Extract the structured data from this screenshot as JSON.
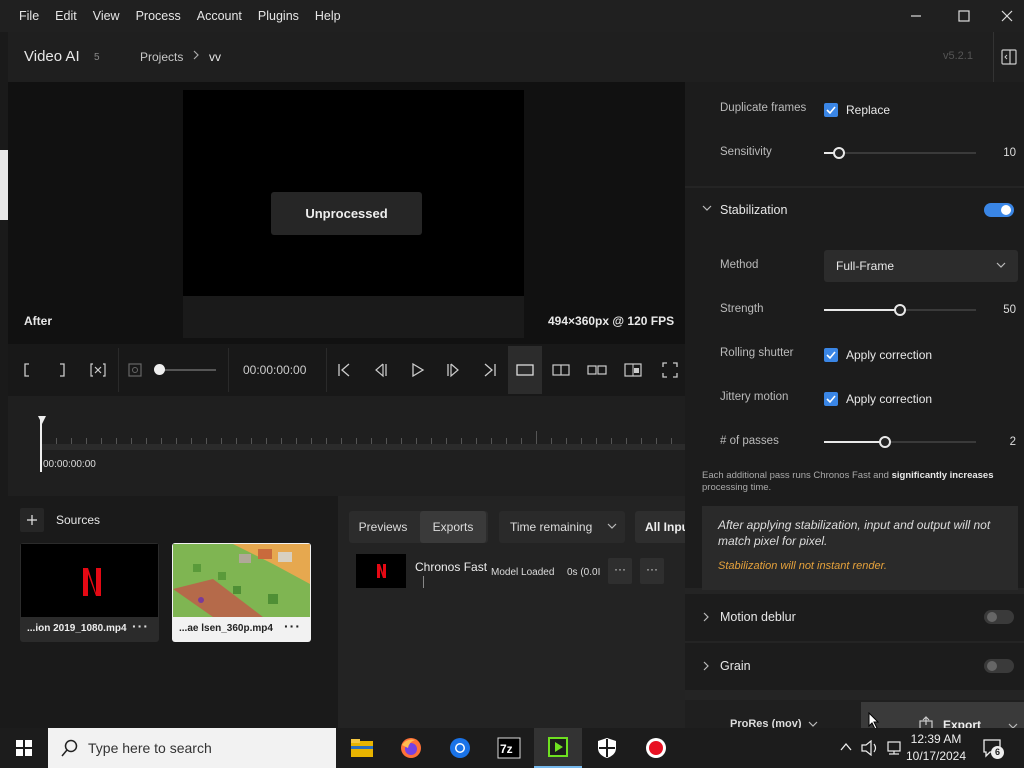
{
  "menu": [
    "File",
    "Edit",
    "View",
    "Process",
    "Account",
    "Plugins",
    "Help"
  ],
  "header": {
    "app_name": "Video AI",
    "count": "5",
    "breadcrumb_root": "Projects",
    "breadcrumb_current": "vv",
    "version": "v5.2.1"
  },
  "viewer": {
    "overlay": "Unprocessed",
    "view_label": "After",
    "resolution": "494×360px @ 120 FPS"
  },
  "controls": {
    "timecode": "00:00:00:00"
  },
  "timeline": {
    "timecode": "00:00:00:00"
  },
  "sources": {
    "title": "Sources",
    "items": [
      {
        "name": "...ion 2019_1080.mp4",
        "more": "···"
      },
      {
        "name": "...ae lsen_360p.mp4",
        "more": "···"
      }
    ]
  },
  "exports": {
    "tab_previews": "Previews",
    "tab_exports": "Exports",
    "sort": "Time remaining",
    "filter": "All Inputs",
    "row": {
      "name": "Chronos Fast",
      "status": "Model Loaded",
      "time": "0s (0.0I",
      "more": "···"
    }
  },
  "panel": {
    "duplicate_frames": {
      "label": "Duplicate frames",
      "option": "Replace"
    },
    "sensitivity": {
      "label": "Sensitivity",
      "value": 10,
      "display": "10"
    },
    "stabilization": {
      "title": "Stabilization",
      "enabled": true
    },
    "method": {
      "label": "Method",
      "value": "Full-Frame"
    },
    "strength": {
      "label": "Strength",
      "value": 50,
      "display": "50"
    },
    "rolling_shutter": {
      "label": "Rolling shutter",
      "option": "Apply correction"
    },
    "jittery_motion": {
      "label": "Jittery motion",
      "option": "Apply correction"
    },
    "passes": {
      "label": "# of passes",
      "value": 2,
      "display": "2"
    },
    "note_part1": "Each additional pass runs Chronos Fast and ",
    "note_bold": "significantly increases",
    "note_part2": " processing time.",
    "info_text": "After applying stabilization, input and output will not match pixel for pixel.",
    "info_warning": "Stabilization will not instant render.",
    "motion_deblur": {
      "title": "Motion deblur",
      "enabled": false
    },
    "grain": {
      "title": "Grain",
      "enabled": false
    }
  },
  "footer": {
    "format": "ProRes (mov)",
    "export": "Export"
  },
  "taskbar": {
    "search_placeholder": "Type here to search",
    "time": "12:39 AM",
    "date": "10/17/2024",
    "notifications": "6"
  },
  "colors": {
    "accent": "#3a86e6",
    "warning": "#e6a23c"
  }
}
